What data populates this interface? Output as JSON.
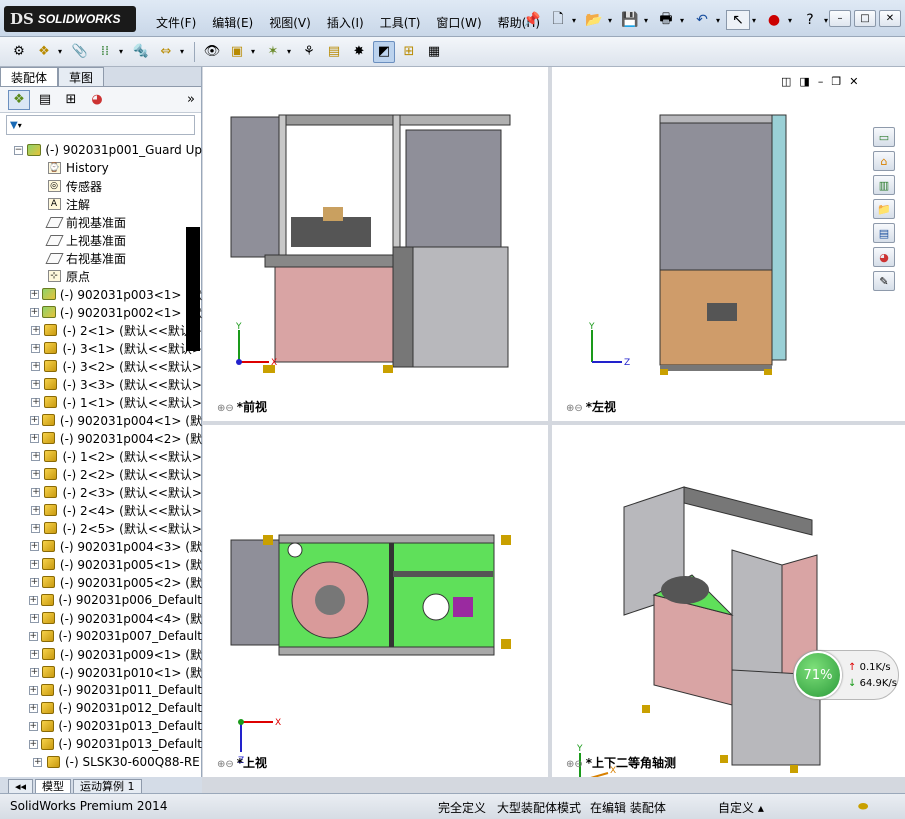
{
  "app": {
    "logo_text": "SOLIDWORKS",
    "logo_ds": "DS"
  },
  "menu": [
    "文件(F)",
    "编辑(E)",
    "视图(V)",
    "插入(I)",
    "工具(T)",
    "窗口(W)",
    "帮助(H)"
  ],
  "sidebar": {
    "tabs": [
      "装配体",
      "草图"
    ],
    "root": "(-) 902031p001_Guard Up",
    "nodes": [
      {
        "label": "History",
        "icon": "history-icon"
      },
      {
        "label": "传感器",
        "icon": "sensor-icon"
      },
      {
        "label": "注解",
        "icon": "annotation-icon"
      },
      {
        "label": "前视基准面",
        "icon": "plane-icon"
      },
      {
        "label": "上视基准面",
        "icon": "plane-icon"
      },
      {
        "label": "右视基准面",
        "icon": "plane-icon"
      },
      {
        "label": "原点",
        "icon": "origin-icon"
      }
    ],
    "components": [
      {
        "label": "(-) 902031p003<1> (默",
        "type": "asm"
      },
      {
        "label": "(-) 902031p002<1> (默",
        "type": "asm"
      },
      {
        "label": "(-) 2<1> (默认<<默认>",
        "type": "part"
      },
      {
        "label": "(-) 3<1> (默认<<默认>",
        "type": "part"
      },
      {
        "label": "(-) 3<2> (默认<<默认>",
        "type": "part"
      },
      {
        "label": "(-) 3<3> (默认<<默认>",
        "type": "part"
      },
      {
        "label": "(-) 1<1> (默认<<默认>",
        "type": "part"
      },
      {
        "label": "(-) 902031p004<1> (默",
        "type": "part"
      },
      {
        "label": "(-) 902031p004<2> (默",
        "type": "part"
      },
      {
        "label": "(-) 1<2> (默认<<默认>",
        "type": "part"
      },
      {
        "label": "(-) 2<2> (默认<<默认>",
        "type": "part"
      },
      {
        "label": "(-) 2<3> (默认<<默认>",
        "type": "part"
      },
      {
        "label": "(-) 2<4> (默认<<默认>",
        "type": "part"
      },
      {
        "label": "(-) 2<5> (默认<<默认>",
        "type": "part"
      },
      {
        "label": "(-) 902031p004<3> (默",
        "type": "part"
      },
      {
        "label": "(-) 902031p005<1> (默",
        "type": "part"
      },
      {
        "label": "(-) 902031p005<2> (默",
        "type": "part"
      },
      {
        "label": "(-) 902031p006_Default",
        "type": "part"
      },
      {
        "label": "(-) 902031p004<4> (默",
        "type": "part"
      },
      {
        "label": "(-) 902031p007_Default",
        "type": "part"
      },
      {
        "label": "(-) 902031p009<1> (默",
        "type": "part"
      },
      {
        "label": "(-) 902031p010<1> (默",
        "type": "part"
      },
      {
        "label": "(-) 902031p011_Default",
        "type": "part"
      },
      {
        "label": "(-) 902031p012_Default",
        "type": "part"
      },
      {
        "label": "(-) 902031p013_Default",
        "type": "part"
      },
      {
        "label": "(-) 902031p013_Default",
        "type": "part"
      },
      {
        "label": "(-) SLSK30-600Q88-RE",
        "type": "part"
      }
    ],
    "bottom_tabs": [
      "模型",
      "运动算例 1"
    ]
  },
  "viewports": [
    {
      "label": "*前视"
    },
    {
      "label": "*左视"
    },
    {
      "label": "*上视"
    },
    {
      "label": "*上下二等角轴测"
    }
  ],
  "axes": {
    "x": "X",
    "y": "Y",
    "z": "Z"
  },
  "network": {
    "percent": "71%",
    "up": "0.1K/s",
    "down": "64.9K/s"
  },
  "status": {
    "product": "SolidWorks Premium 2014",
    "defined": "完全定义",
    "mode": "大型装配体模式",
    "editing": "在编辑 装配体",
    "custom": "自定义"
  },
  "colors": {
    "green_plate": "#5fe05a",
    "panel_pink": "#d9a4a4",
    "panel_brown": "#cf9c6a",
    "glass": "#8f8f99"
  }
}
